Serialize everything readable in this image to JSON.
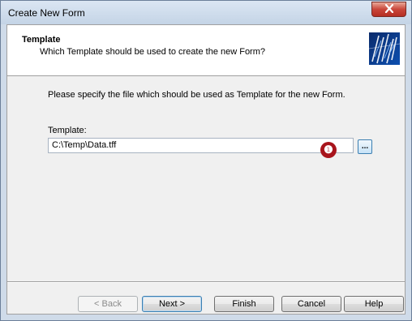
{
  "window": {
    "title": "Create New Form",
    "close_symbol": "✕"
  },
  "header": {
    "title": "Template",
    "subtitle": "Which Template should be used to create the new Form?",
    "logo_icon": "wizard-banner-icon"
  },
  "main": {
    "instruction": "Please specify the file which should be used as Template for the new Form.",
    "template_label": "Template:",
    "template_value": "C:\\Temp\\Data.tff",
    "browse_label": "...",
    "callout_number": "❶"
  },
  "buttons": {
    "back": "< Back",
    "next": "Next >",
    "finish": "Finish",
    "cancel": "Cancel",
    "help": "Help"
  },
  "colors": {
    "callout": "#a8141c",
    "close_button": "#c9463a",
    "window_frame": "#cfdbe9"
  }
}
